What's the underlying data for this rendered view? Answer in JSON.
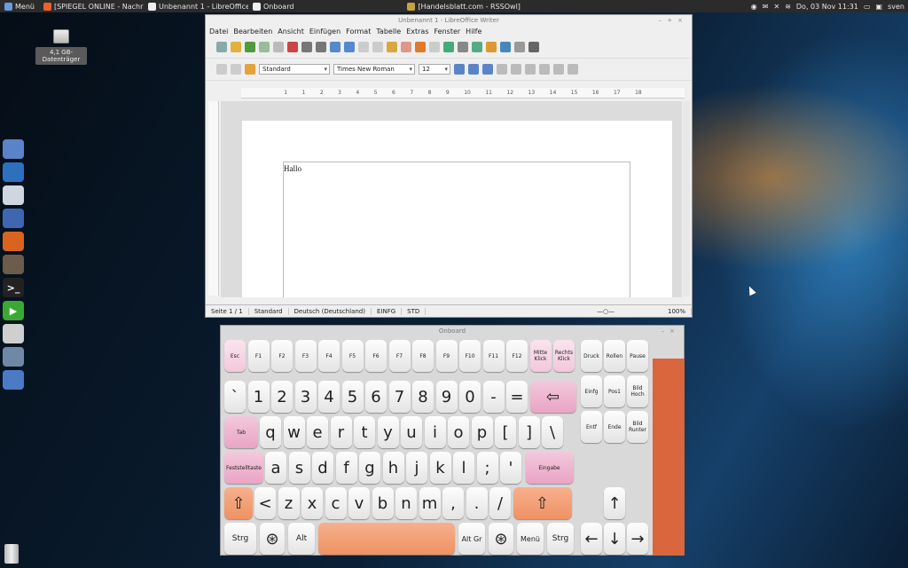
{
  "taskbar": {
    "menu_label": "Menü",
    "tasks": [
      {
        "label": "[SPIEGEL ONLINE - Nachrich...",
        "color": "#e8632a"
      },
      {
        "label": "Unbenannt 1 - LibreOffice W...",
        "color": "#eeeeee"
      },
      {
        "label": "Onboard",
        "color": "#f0f0f0"
      },
      {
        "label": "[Handelsblatt.com - RSSOwl]",
        "color": "#c9a23b"
      }
    ],
    "clock": "Do, 03 Nov  11:31",
    "user": "sven"
  },
  "desktop": {
    "drive_label": "4,1 GB-Datenträger"
  },
  "dock": [
    {
      "name": "files",
      "color": "#5b83c7",
      "glyph": ""
    },
    {
      "name": "browser",
      "color": "#2f6fc0",
      "glyph": ""
    },
    {
      "name": "mail",
      "color": "#d0d6df",
      "glyph": ""
    },
    {
      "name": "writer",
      "color": "#3d67b1",
      "glyph": ""
    },
    {
      "name": "firefox",
      "color": "#d8641f",
      "glyph": ""
    },
    {
      "name": "gimp",
      "color": "#6b5d4a",
      "glyph": ""
    },
    {
      "name": "terminal",
      "color": "#222222",
      "glyph": ">_"
    },
    {
      "name": "player",
      "color": "#3aa832",
      "glyph": "▶"
    },
    {
      "name": "disc",
      "color": "#cfcfcf",
      "glyph": ""
    },
    {
      "name": "settings",
      "color": "#6f88a8",
      "glyph": ""
    },
    {
      "name": "folder",
      "color": "#4b7bc5",
      "glyph": ""
    }
  ],
  "writer": {
    "title": "Unbenannt 1 - LibreOffice Writer",
    "menu": [
      "Datei",
      "Bearbeiten",
      "Ansicht",
      "Einfügen",
      "Format",
      "Tabelle",
      "Extras",
      "Fenster",
      "Hilfe"
    ],
    "style_select": "Standard",
    "font_select": "Times New Roman",
    "size_select": "12",
    "ruler_marks": [
      "1",
      "1",
      "2",
      "3",
      "4",
      "5",
      "6",
      "7",
      "8",
      "9",
      "10",
      "11",
      "12",
      "13",
      "14",
      "15",
      "16",
      "17",
      "18"
    ],
    "doc_text": "Hallo",
    "status": {
      "page": "Seite 1 / 1",
      "style": "Standard",
      "language": "Deutsch (Deutschland)",
      "insert": "EINFG",
      "sel": "STD",
      "zoom": "100%"
    }
  },
  "onboard": {
    "title": "Onboard",
    "row_fn": [
      {
        "label": "Esc",
        "style": "lpink",
        "w": 25
      },
      {
        "label": "F1"
      },
      {
        "label": "F2"
      },
      {
        "label": "F3"
      },
      {
        "label": "F4"
      },
      {
        "label": "F5"
      },
      {
        "label": "F6"
      },
      {
        "label": "F7"
      },
      {
        "label": "F8"
      },
      {
        "label": "F9"
      },
      {
        "label": "F10"
      },
      {
        "label": "F11"
      },
      {
        "label": "F12"
      },
      {
        "label": "Mitte Klick",
        "style": "lpink"
      },
      {
        "label": "Rechts Klick",
        "style": "lpink"
      }
    ],
    "row_num": [
      "`",
      "1",
      "2",
      "3",
      "4",
      "5",
      "6",
      "7",
      "8",
      "9",
      "0",
      "-",
      "="
    ],
    "backspace": "⇦",
    "tab": "Tab",
    "row_q": [
      "q",
      "w",
      "e",
      "r",
      "t",
      "y",
      "u",
      "i",
      "o",
      "p",
      "[",
      "]",
      "\\"
    ],
    "caps": "Feststelltaste",
    "row_a": [
      "a",
      "s",
      "d",
      "f",
      "g",
      "h",
      "j",
      "k",
      "l",
      ";",
      "'"
    ],
    "enter": "Eingabe",
    "shift": "⇧",
    "row_z": [
      "<",
      "z",
      "x",
      "c",
      "v",
      "b",
      "n",
      "m",
      ",",
      ".",
      "/"
    ],
    "bottom": {
      "ctrl": "Strg",
      "super": "⊛",
      "alt": "Alt",
      "altgr": "Alt Gr",
      "menu": "Menü"
    },
    "nav": [
      [
        "Druck",
        "Rollen",
        "Pause"
      ],
      [
        "Einfg",
        "Pos1",
        "Bild Hoch"
      ],
      [
        "Entf",
        "Ende",
        "Bild Runter"
      ]
    ],
    "arrows": {
      "up": "↑",
      "left": "←",
      "down": "↓",
      "right": "→"
    }
  }
}
